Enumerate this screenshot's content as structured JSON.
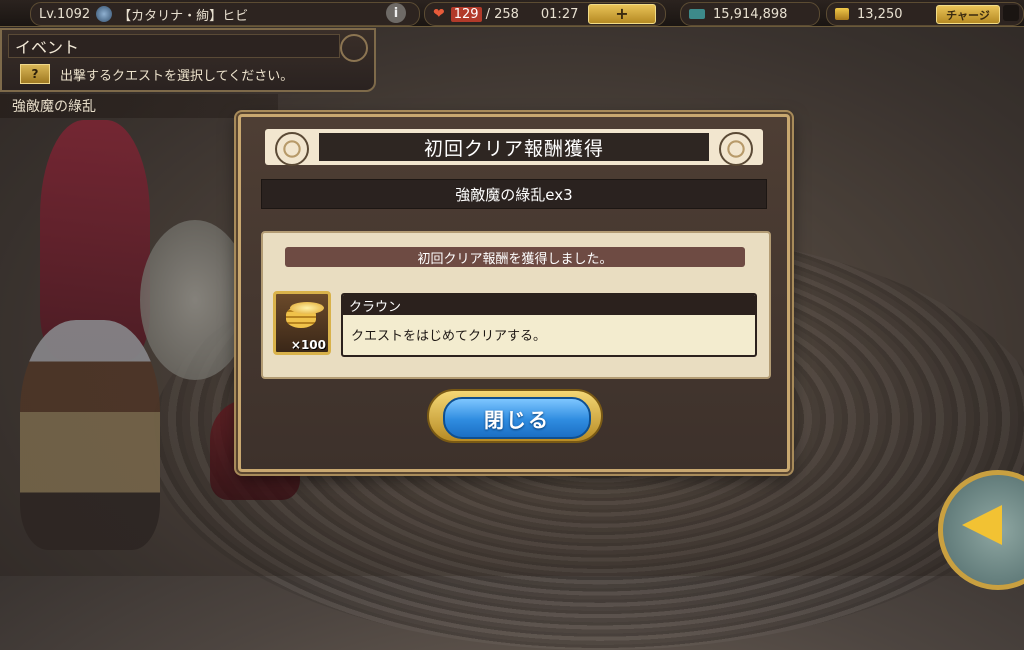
{
  "topbar": {
    "level": "Lv.1092",
    "player_name": "【カタリナ・絢】ヒビ",
    "stamina_current": "129",
    "stamina_max": "/ 258",
    "timer": "01:27",
    "plus_label": "+",
    "gold": "15,914,898",
    "crowns": "13,250",
    "charge_label": "チャージ"
  },
  "header": {
    "title": "イベント",
    "help_label": "?",
    "instruction": "出撃するクエストを選択してください。"
  },
  "quest_label": "強敵魔の綠乱",
  "dialog": {
    "title": "初回クリア報酬獲得",
    "stage": "強敵魔の綠乱ex3",
    "reward_message": "初回クリア報酬を獲得しました。",
    "item_name": "クラウン",
    "item_description": "クエストをはじめてクリアする。",
    "item_quantity": "×100",
    "close_label": "閉じる"
  },
  "colors": {
    "accent_gold": "#c9a870",
    "button_blue": "#2f8ce0",
    "dialog_bg": "#3d312b"
  },
  "icons": [
    "avatar-icon",
    "info-icon",
    "heart-icon",
    "gold-icon",
    "crown-icon",
    "crown-coin-icon",
    "back-arrow-icon"
  ]
}
